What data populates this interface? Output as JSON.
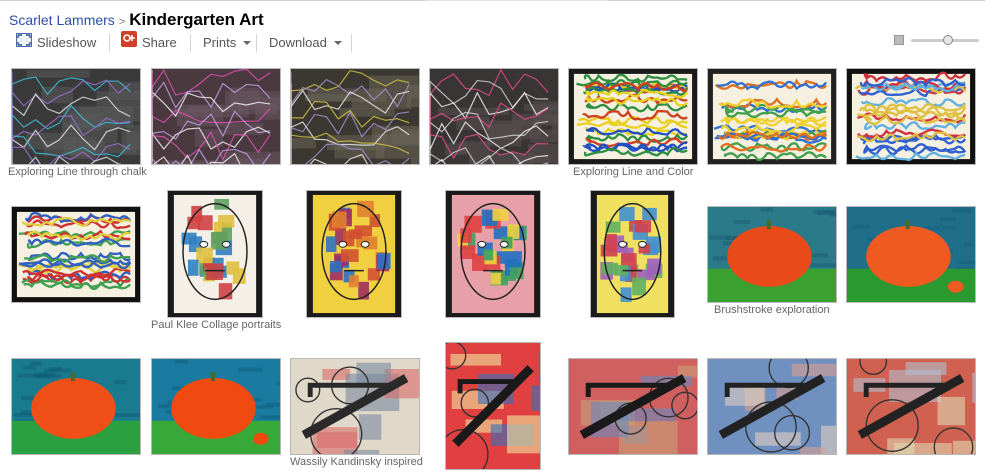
{
  "breadcrumb": {
    "owner": "Scarlet Lammers",
    "separator": ">",
    "album_title": "Kindergarten Art"
  },
  "toolbar": {
    "slideshow_label": "Slideshow",
    "share_label": "Share",
    "prints_label": "Prints",
    "download_label": "Download"
  },
  "zoom": {
    "level": 0.55
  },
  "photos": [
    {
      "name": "photo-chalk-lines-1",
      "theme": "chalk",
      "palette": [
        "#3a3a3a",
        "#5a5a5a",
        "#39c0d8",
        "#9c6fd0",
        "#e0e0e0"
      ],
      "caption": "Exploring Line through chalk"
    },
    {
      "name": "photo-chalk-lines-2",
      "theme": "chalk",
      "palette": [
        "#4a3a40",
        "#6a5560",
        "#e050b0",
        "#c0a0e0",
        "#f0f0f0"
      ],
      "caption": ""
    },
    {
      "name": "photo-chalk-lines-3",
      "theme": "chalk",
      "palette": [
        "#3a3830",
        "#6a6458",
        "#d0c040",
        "#a090d0",
        "#e8e8e8"
      ],
      "caption": ""
    },
    {
      "name": "photo-chalk-lines-4",
      "theme": "chalk",
      "palette": [
        "#3a3535",
        "#5a5050",
        "#e04a8a",
        "#d0d0d0",
        "#f0f0f0"
      ],
      "caption": ""
    },
    {
      "name": "photo-line-color-1",
      "theme": "color",
      "palette": [
        "#1a1a1a",
        "#e8d020",
        "#2f8f40",
        "#d04020",
        "#2050c0"
      ],
      "caption": "Exploring Line and Color"
    },
    {
      "name": "photo-line-color-2",
      "theme": "color",
      "palette": [
        "#222",
        "#f0d030",
        "#e07020",
        "#3070d0",
        "#40a050"
      ],
      "caption": ""
    },
    {
      "name": "photo-line-color-3",
      "theme": "color",
      "palette": [
        "#111",
        "#3060d0",
        "#e0c040",
        "#d03040",
        "#60b0e0"
      ],
      "caption": ""
    },
    {
      "name": "photo-line-color-4",
      "theme": "color",
      "palette": [
        "#111",
        "#d03030",
        "#3060c0",
        "#e0d040",
        "#40a050"
      ],
      "caption": ""
    },
    {
      "name": "photo-klee-portrait-1",
      "theme": "klee",
      "palette": [
        "#f4f0e8",
        "#d04040",
        "#3080c0",
        "#e0c040",
        "#60a060"
      ],
      "caption": "Paul Klee Collage portraits"
    },
    {
      "name": "photo-klee-portrait-2",
      "theme": "klee",
      "palette": [
        "#f0d040",
        "#d05030",
        "#e08030",
        "#a03060",
        "#3070c0"
      ],
      "caption": ""
    },
    {
      "name": "photo-klee-portrait-3",
      "theme": "klee",
      "palette": [
        "#e8a0a8",
        "#40a060",
        "#2070c0",
        "#e04040",
        "#f0d040"
      ],
      "caption": ""
    },
    {
      "name": "photo-klee-portrait-4",
      "theme": "klee",
      "palette": [
        "#f0e060",
        "#4090d0",
        "#d04050",
        "#60b060",
        "#a060c0"
      ],
      "caption": ""
    },
    {
      "name": "photo-brushstroke-1",
      "theme": "pumpkin",
      "palette": [
        "#2a7a8a",
        "#e84a1a",
        "#3aa030",
        "#1a5a70"
      ],
      "caption": "Brushstroke exploration"
    },
    {
      "name": "photo-brushstroke-2",
      "theme": "pumpkin",
      "palette": [
        "#1f6f8a",
        "#ee5a20",
        "#2a9a30",
        "#156080"
      ],
      "caption": ""
    },
    {
      "name": "photo-brushstroke-3",
      "theme": "pumpkin",
      "palette": [
        "#1a7a90",
        "#f05018",
        "#2aa040",
        "#0f5a78"
      ],
      "caption": ""
    },
    {
      "name": "photo-brushstroke-4",
      "theme": "pumpkin",
      "palette": [
        "#1a7aa0",
        "#f04a10",
        "#38a838",
        "#10607a"
      ],
      "caption": ""
    },
    {
      "name": "photo-kandinsky-1",
      "theme": "kandinsky",
      "palette": [
        "#d86a6a",
        "#2a2a2a",
        "#e0d8c8",
        "#7a8aa0"
      ],
      "caption": "Wassily Kandinsky inspired"
    },
    {
      "name": "photo-kandinsky-2",
      "theme": "kandinsky",
      "palette": [
        "#f0e8a0",
        "#1a1a1a",
        "#e04040",
        "#3070c0"
      ],
      "caption": ""
    },
    {
      "name": "photo-kandinsky-3",
      "theme": "kandinsky",
      "palette": [
        "#c8a078",
        "#1a1a1a",
        "#d06060",
        "#6a8ac0"
      ],
      "caption": ""
    },
    {
      "name": "photo-kandinsky-4",
      "theme": "kandinsky",
      "palette": [
        "#d8a090",
        "#222",
        "#7090c0",
        "#e0d0c0"
      ],
      "caption": ""
    },
    {
      "name": "photo-kandinsky-5",
      "theme": "kandinsky",
      "palette": [
        "#b0c0d0",
        "#222",
        "#d06050",
        "#e0d8b0"
      ],
      "caption": ""
    }
  ]
}
